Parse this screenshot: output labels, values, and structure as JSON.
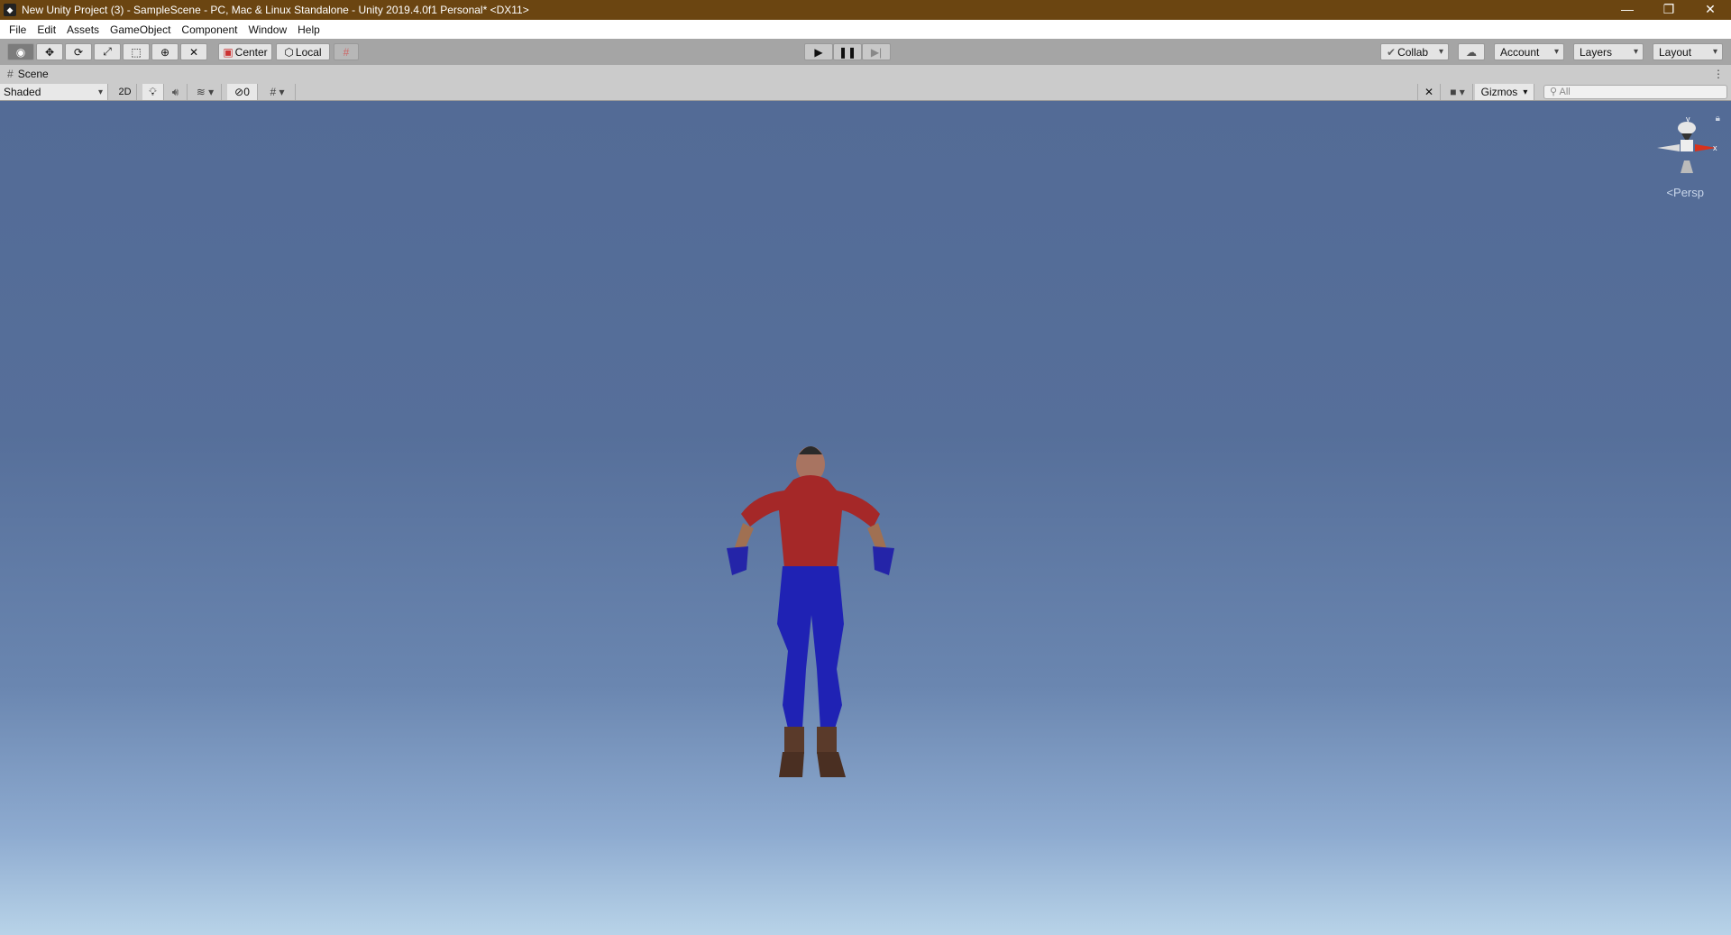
{
  "window": {
    "title": "New Unity Project (3) - SampleScene - PC, Mac & Linux Standalone - Unity 2019.4.0f1 Personal* <DX11>",
    "minimize": "—",
    "restore": "❐",
    "close": "✕"
  },
  "menu": [
    "File",
    "Edit",
    "Assets",
    "GameObject",
    "Component",
    "Window",
    "Help"
  ],
  "toolbar": {
    "pivot": "Center",
    "space": "Local",
    "collab": "Collab",
    "account": "Account",
    "layers": "Layers",
    "layout": "Layout"
  },
  "scene": {
    "tab": "Scene",
    "draw_mode": "Shaded",
    "mode2d": "2D",
    "hidden_count": "0",
    "gizmos": "Gizmos",
    "search_placeholder": "All",
    "projection": "Persp",
    "axis_x": "x",
    "axis_y": "y"
  }
}
